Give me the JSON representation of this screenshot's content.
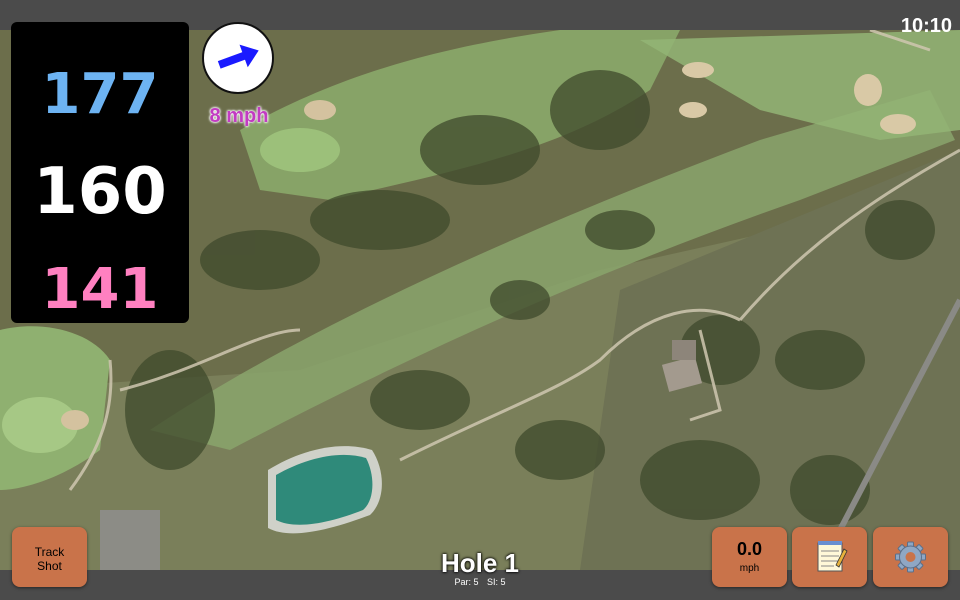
{
  "status": {
    "time": "10:10"
  },
  "yardages": {
    "back": "177",
    "middle": "160",
    "front": "141"
  },
  "wind": {
    "speed": "8 mph",
    "icon": "wind-arrow-icon",
    "arrow_color": "#1a1aff"
  },
  "buttons": {
    "track_shot_line1": "Track",
    "track_shot_line2": "Shot",
    "speed_value": "0.0",
    "speed_unit": "mph",
    "notes_icon": "notepad-icon",
    "settings_icon": "gear-icon"
  },
  "hole": {
    "title": "Hole 1",
    "par": "Par: 5",
    "si": "SI: 5"
  },
  "colors": {
    "button": "#c9734a",
    "back": "#6db3f2",
    "front": "#ff80c0",
    "wind_text": "#c23bc2"
  }
}
